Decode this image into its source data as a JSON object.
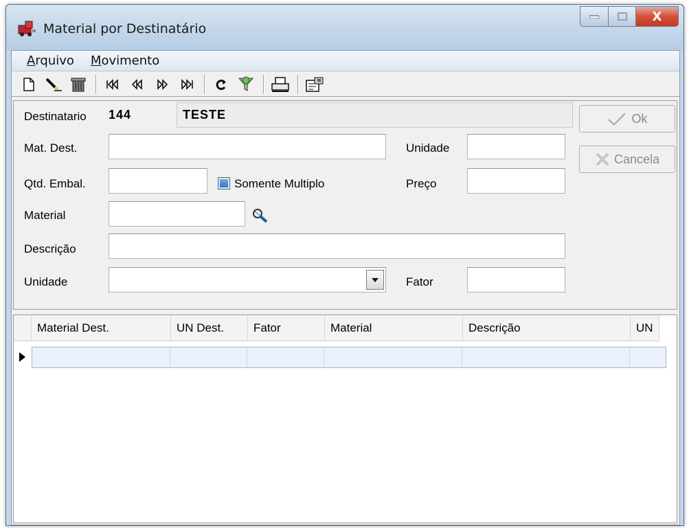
{
  "window": {
    "title": "Material por Destinatário",
    "close_glyph": "X"
  },
  "menu": {
    "items": [
      {
        "first": "A",
        "rest": "rquivo"
      },
      {
        "first": "M",
        "rest": "ovimento"
      }
    ]
  },
  "toolbar": {
    "buttons": [
      "new-document-icon",
      "edit-pencil-icon",
      "trash-icon",
      "first-record-icon",
      "previous-record-icon",
      "next-record-icon",
      "last-record-icon",
      "refresh-icon",
      "filter-icon",
      "print-icon",
      "properties-icon"
    ]
  },
  "form": {
    "destinatario_label": "Destinatario",
    "destinatario_code": "144",
    "destinatario_name": "TESTE",
    "mat_dest_label": "Mat. Dest.",
    "unidade_label": "Unidade",
    "qtd_embal_label": "Qtd. Embal.",
    "somente_multiplo_label": "Somente Multiplo",
    "preco_label": "Preço",
    "material_label": "Material",
    "descricao_label": "Descrição",
    "unidade2_label": "Unidade",
    "fator_label": "Fator",
    "ok_label": "Ok",
    "cancela_label": "Cancela"
  },
  "grid": {
    "columns": [
      "Material Dest.",
      "UN Dest.",
      "Fator",
      "Material",
      "Descrição",
      "UN"
    ]
  },
  "colors": {
    "title_bar": "#c6d9ec",
    "close_button": "#c9432b",
    "checkbox": "#2f6db2",
    "grid_row": "#eaf1fb"
  }
}
